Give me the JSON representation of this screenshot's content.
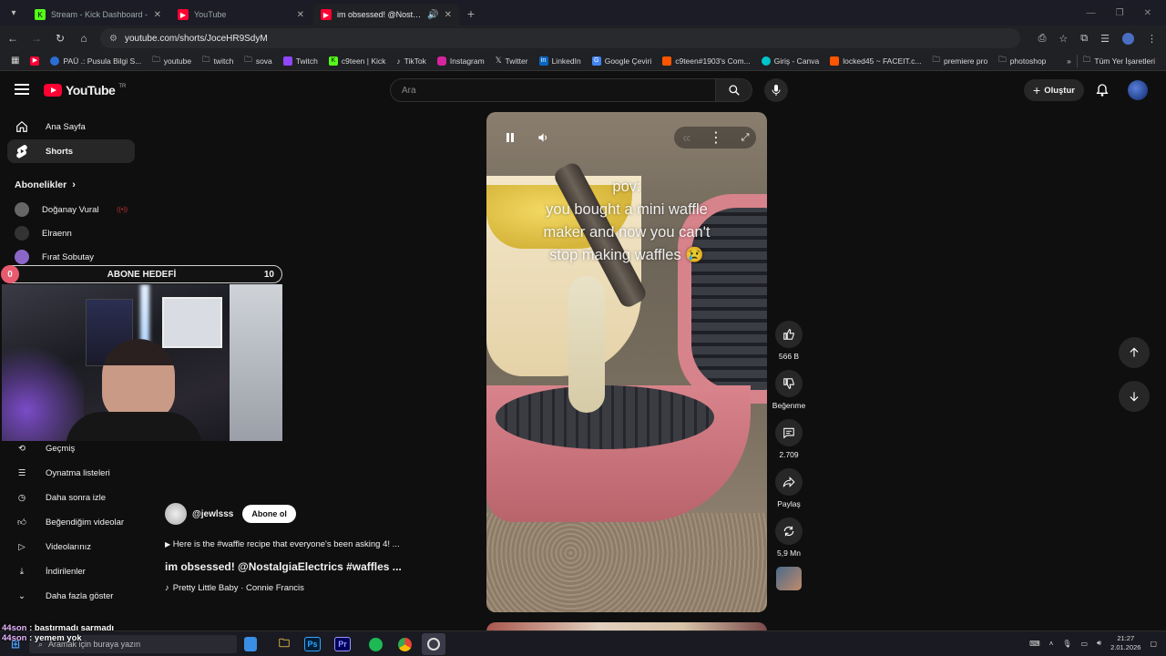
{
  "browser": {
    "tabs": [
      {
        "title": "Stream - Kick Dashboard -",
        "icon": "kick-icon",
        "color": "#53fc18",
        "active": false
      },
      {
        "title": "YouTube",
        "icon": "youtube-icon",
        "color": "#ff0033",
        "active": false
      },
      {
        "title": "im obsessed! @NostalgiaEl",
        "icon": "youtube-icon",
        "color": "#ff0033",
        "active": true
      }
    ],
    "url": "youtube.com/shorts/JoceHR9SdyM",
    "bookmarks": [
      {
        "label": "",
        "icon": "youtube-icon",
        "color": "#ff0033"
      },
      {
        "label": "PAÜ .: Pusula Bilgi S...",
        "icon": "pau-icon",
        "color": "#2a6fd6"
      },
      {
        "label": "youtube",
        "icon": "folder-icon",
        "color": ""
      },
      {
        "label": "twitch",
        "icon": "folder-icon",
        "color": ""
      },
      {
        "label": "sova",
        "icon": "folder-icon",
        "color": ""
      },
      {
        "label": "Twitch",
        "icon": "twitch-icon",
        "color": "#9146ff"
      },
      {
        "label": "c9teen | Kick",
        "icon": "kick-icon",
        "color": "#53fc18"
      },
      {
        "label": "TikTok",
        "icon": "tiktok-icon",
        "color": "#111111"
      },
      {
        "label": "Instagram",
        "icon": "instagram-icon",
        "color": "#d6249f"
      },
      {
        "label": "Twitter",
        "icon": "x-icon",
        "color": "#111111"
      },
      {
        "label": "LinkedIn",
        "icon": "linkedin-icon",
        "color": "#0a66c2"
      },
      {
        "label": "Google Çeviri",
        "icon": "translate-icon",
        "color": "#4285f4"
      },
      {
        "label": "c9teen#1903's Com...",
        "icon": "faceit-icon",
        "color": "#ff5500"
      },
      {
        "label": "Giriş - Canva",
        "icon": "canva-icon",
        "color": "#00c4cc"
      },
      {
        "label": "locked45 ~ FACEIT.c...",
        "icon": "faceit-icon",
        "color": "#ff5500"
      },
      {
        "label": "premiere pro",
        "icon": "folder-icon",
        "color": ""
      },
      {
        "label": "photoshop",
        "icon": "folder-icon",
        "color": ""
      }
    ],
    "all_bookmarks": "Tüm Yer İşaretleri"
  },
  "youtube": {
    "logo": "YouTube",
    "logo_country": "TR",
    "search_placeholder": "Ara",
    "create_label": "Oluştur",
    "sidebar": {
      "items": [
        {
          "label": "Ana Sayfa",
          "icon": "home-icon",
          "active": false
        },
        {
          "label": "Shorts",
          "icon": "shorts-icon",
          "active": true
        }
      ],
      "subscriptions_header": "Abonelikler",
      "subscriptions": [
        {
          "name": "Doğanay Vural",
          "live": true,
          "color": "#666666"
        },
        {
          "name": "Elraenn",
          "live": false,
          "color": "#333333"
        },
        {
          "name": "Fırat Sobutay",
          "live": false,
          "color": "#8a66c8"
        }
      ],
      "lower_items": [
        {
          "label": "Geçmiş",
          "icon": "history-icon"
        },
        {
          "label": "Oynatma listeleri",
          "icon": "playlist-icon"
        },
        {
          "label": "Daha sonra izle",
          "icon": "clock-icon"
        },
        {
          "label": "Beğendiğim videolar",
          "icon": "thumb-up-icon"
        },
        {
          "label": "Videolarınız",
          "icon": "video-icon"
        },
        {
          "label": "İndirilenler",
          "icon": "download-icon"
        },
        {
          "label": "Daha fazla göster",
          "icon": "chevron-down-icon"
        }
      ]
    },
    "short": {
      "overlay_text": [
        "pov:",
        "you bought a mini waffle",
        "maker and now you can't",
        "stop making waffles 😢"
      ],
      "channel": "@jewlsss",
      "subscribe_label": "Abone ol",
      "description": "Here is the #waffle recipe that everyone's been asking 4! ...",
      "title": "im obsessed! @NostalgiaElectrics  #waffles ...",
      "music": "Pretty Little Baby · Connie Francis"
    },
    "actions": {
      "like_count": "566 B",
      "dislike_label": "Beğenme",
      "comment_count": "2.709",
      "share_label": "Paylaş",
      "remix_count": "5,9 Mn"
    }
  },
  "stream_overlay": {
    "goal_label": "ABONE HEDEFİ",
    "goal_current": "0",
    "goal_target": "10",
    "chat": [
      {
        "user": "44son",
        "message": "bastırmadı sarmadı"
      },
      {
        "user": "44son",
        "message": "yemem yok"
      }
    ]
  },
  "taskbar": {
    "search_placeholder": "Aramak için buraya yazın",
    "time": "21:27",
    "date": "2.01.2026",
    "apps": [
      {
        "label": "",
        "icon": "calculator-icon",
        "color": "#3a8ee6"
      },
      {
        "label": "",
        "icon": "file-explorer-icon",
        "color": "#f2c94c"
      },
      {
        "label": "Ps",
        "icon": "photoshop-icon",
        "color": "#31a8ff"
      },
      {
        "label": "Pr",
        "icon": "premiere-icon",
        "color": "#9999ff"
      },
      {
        "label": "",
        "icon": "spotify-icon",
        "color": "#1db954"
      },
      {
        "label": "",
        "icon": "chrome-icon",
        "color": "#fbbc05"
      },
      {
        "label": "",
        "icon": "obs-icon",
        "color": "#dddddd"
      }
    ]
  }
}
